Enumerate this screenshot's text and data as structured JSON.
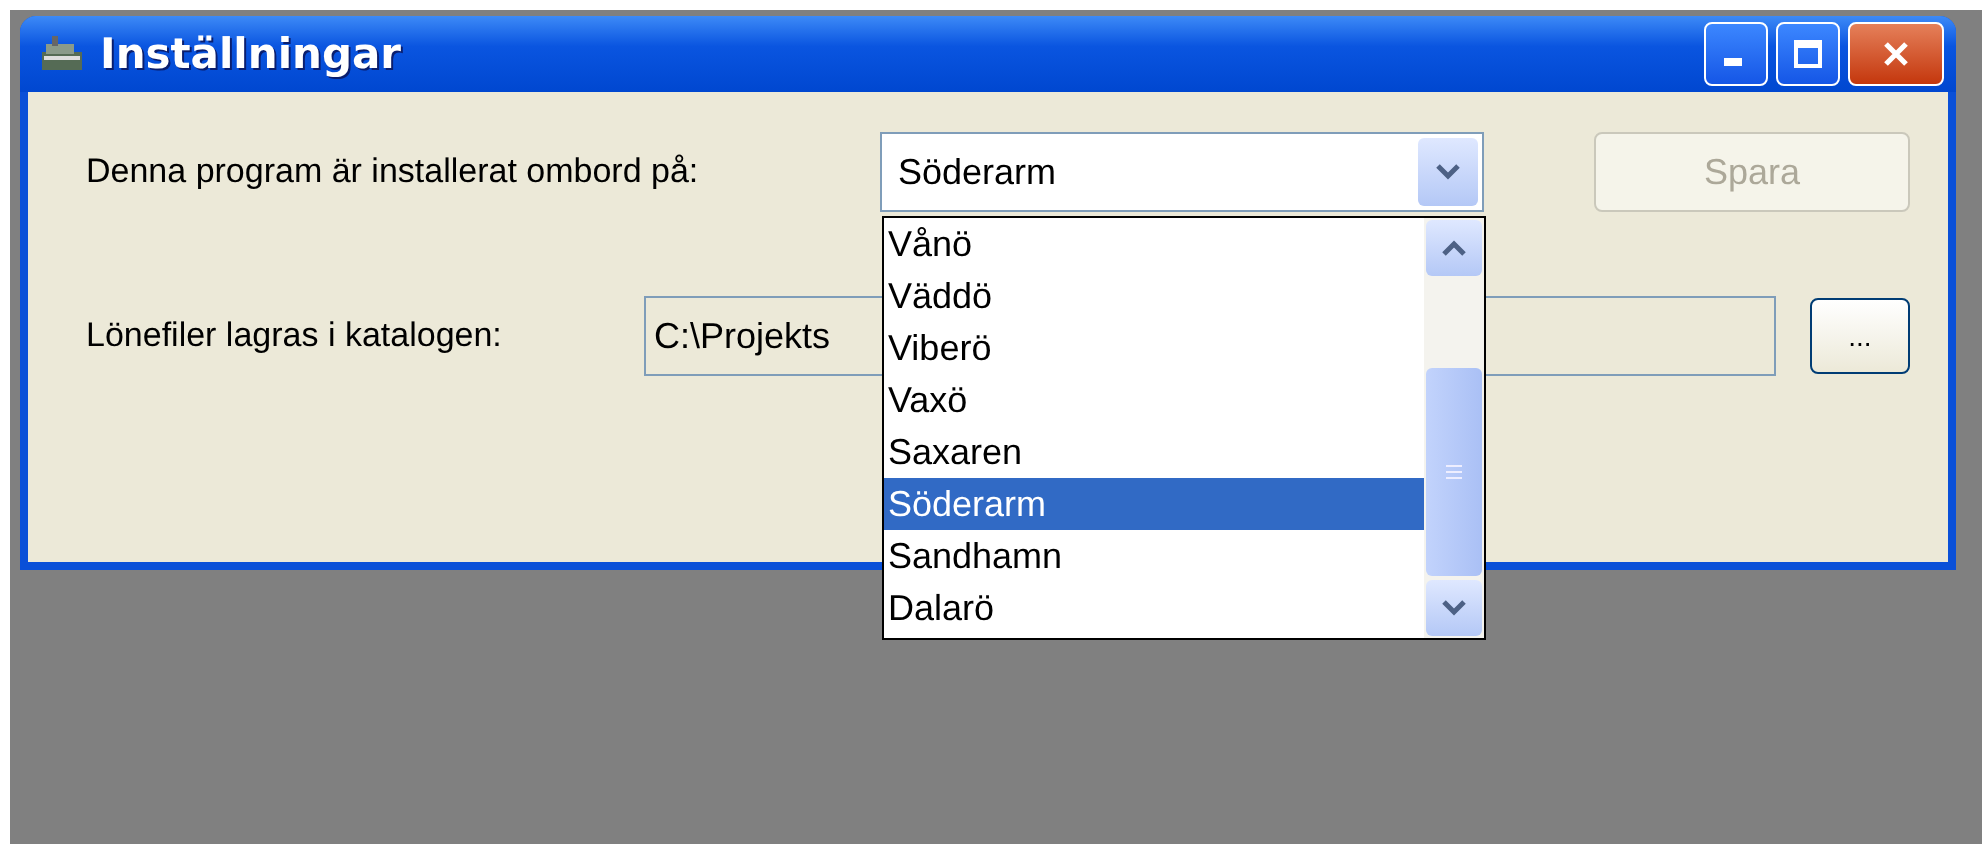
{
  "window": {
    "title": "Inställningar"
  },
  "install": {
    "label": "Denna program är installerat ombord på:",
    "value": "Söderarm"
  },
  "save_button": {
    "label": "Spara",
    "disabled": true
  },
  "dropdown": {
    "items": [
      {
        "label": "Vånö",
        "selected": false
      },
      {
        "label": "Väddö",
        "selected": false
      },
      {
        "label": "Viberö",
        "selected": false
      },
      {
        "label": "Vaxö",
        "selected": false
      },
      {
        "label": "Saxaren",
        "selected": false
      },
      {
        "label": "Söderarm",
        "selected": true
      },
      {
        "label": "Sandhamn",
        "selected": false
      },
      {
        "label": "Dalarö",
        "selected": false
      }
    ]
  },
  "folder": {
    "label": "Lönefiler lagras i katalogen:",
    "value": "C:\\Projekts"
  },
  "browse_button": {
    "label": "..."
  }
}
